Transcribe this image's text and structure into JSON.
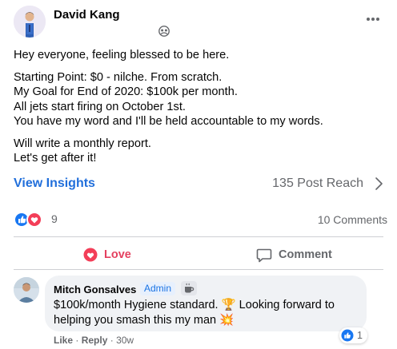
{
  "post": {
    "author": "David Kang",
    "audience_icon": "group-audience-icon",
    "more_icon": "more-options-icon",
    "text_lines": [
      [
        "Hey everyone, feeling blessed to be here."
      ],
      [
        "Starting Point: $0 - nilche. From scratch.",
        "My Goal for End of 2020: $100k per month.",
        "All jets start firing on October 1st.",
        "You have my word and I'll be held accountable to my words."
      ],
      [
        "Will write a monthly report.",
        "Let's get after it!"
      ]
    ],
    "insights_label": "View Insights",
    "reach_label": "135 Post Reach",
    "reaction_count": "9",
    "comments_label": "10 Comments",
    "love_label": "Love",
    "comment_label": "Comment"
  },
  "comment": {
    "author": "Mitch Gonsalves",
    "badge": "Admin",
    "badge_icon": "coffee-cup-icon",
    "text_a": "$100k/month Hygiene standard.",
    "trophy": "🏆",
    "text_b": " Looking forward to helping you smash this my man",
    "boom": "💥",
    "like_count": "1",
    "like_label": "Like",
    "reply_label": "Reply",
    "sep": "·",
    "age": "30w"
  },
  "colors": {
    "link_blue": "#216fdb",
    "love_red": "#e4405f",
    "muted": "#65676b",
    "like_blue": "#1877f2"
  }
}
